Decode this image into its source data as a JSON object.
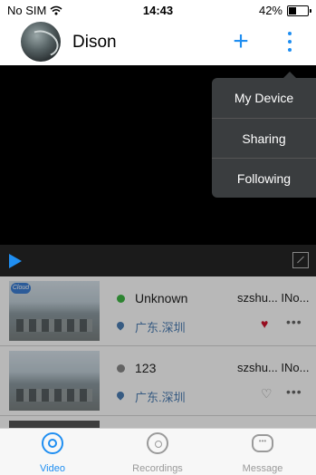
{
  "status_bar": {
    "carrier": "No SIM",
    "time": "14:43",
    "battery_text": "42%",
    "battery_level": 0.42
  },
  "header": {
    "user_name": "Dison",
    "add_label": "+",
    "more_icon": "more-vertical-icon"
  },
  "menu": {
    "items": [
      {
        "label": "My Device"
      },
      {
        "label": "Sharing"
      },
      {
        "label": "Following"
      }
    ]
  },
  "devices": [
    {
      "badge": "Cloud",
      "name": "Unknown",
      "owner": "szshu... INo...",
      "location": "广东.深圳",
      "status_color": "#3fb845",
      "favorite": "♥",
      "favorite_color": "#d0112b",
      "more": "•••"
    },
    {
      "badge": "",
      "name": "123",
      "owner": "szshu... INo...",
      "location": "广东.深圳",
      "status_color": "#8a8a8a",
      "favorite": "♡",
      "favorite_color": "#9a9a9a",
      "more": "•••"
    }
  ],
  "tabs": [
    {
      "label": "Video",
      "icon": "video-icon",
      "active": true
    },
    {
      "label": "Recordings",
      "icon": "recordings-icon",
      "active": false
    },
    {
      "label": "Message",
      "icon": "message-icon",
      "active": false
    }
  ],
  "colors": {
    "accent": "#1f8ef1",
    "menu_bg": "#3a3d3f"
  }
}
